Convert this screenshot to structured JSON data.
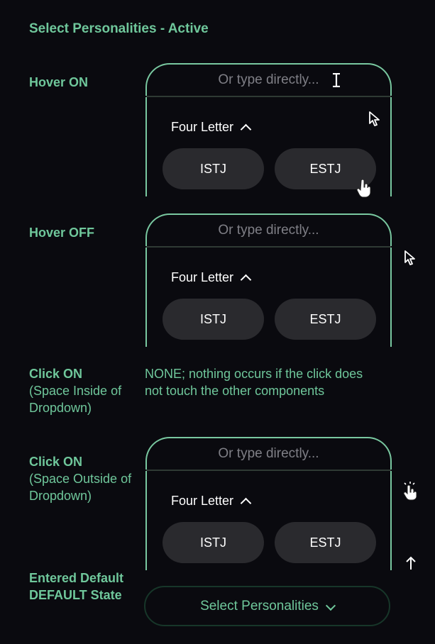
{
  "title": "Select Personalities - Active",
  "states": [
    {
      "label": "Hover ON",
      "sub": ""
    },
    {
      "label": "Hover OFF",
      "sub": ""
    },
    {
      "label": "Click ON",
      "sub": "(Space Inside of Dropdown)"
    },
    {
      "label": "Click ON",
      "sub": "(Space Outside of Dropdown)"
    },
    {
      "label": "Entered Default DEFAULT State",
      "sub": ""
    }
  ],
  "note": "NONE; nothing occurs if the click does not touch the other components",
  "dropdown": {
    "placeholder": "Or type directly...",
    "group_label": "Four Letter",
    "options": [
      "ISTJ",
      "ESTJ"
    ]
  },
  "select": {
    "label": "Select Personalities"
  },
  "icons": {
    "text_cursor": "i-beam-cursor-icon",
    "arrow_cursor": "arrow-cursor-icon",
    "hand_cursor": "pointer-hand-icon",
    "click_cursor": "click-hand-icon",
    "scroll_up": "arrow-up-icon",
    "caret_up": "caret-up-icon",
    "chevron_down": "chevron-down-icon"
  },
  "colors": {
    "background": "#0a0a0f",
    "accent": "#6fc79b",
    "border": "#79c8a0",
    "pill": "#2a2a2e"
  }
}
